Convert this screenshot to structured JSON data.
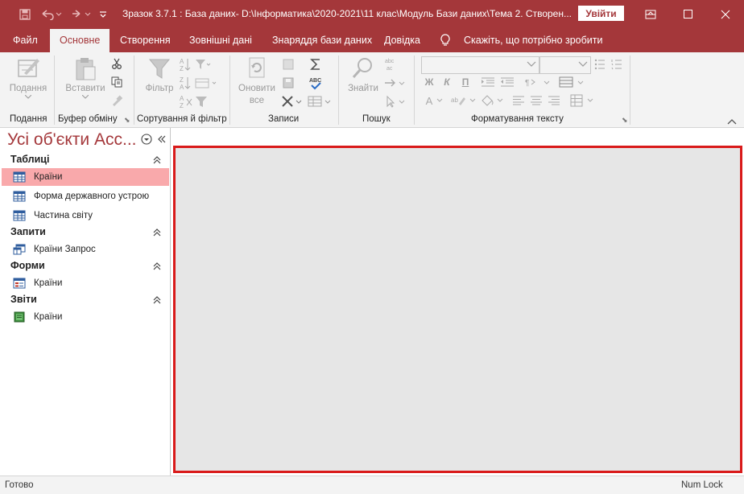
{
  "window": {
    "title": "Зразок 3.7.1 : База даних- D:\\Інформатика\\2020-2021\\11 клас\\Модуль Бази даних\\Тема 2. Створен...",
    "signin_label": "Увійти"
  },
  "tabs": [
    {
      "label": "Файл"
    },
    {
      "label": "Основне"
    },
    {
      "label": "Створення"
    },
    {
      "label": "Зовнішні дані"
    },
    {
      "label": "Знаряддя бази даних"
    },
    {
      "label": "Довідка"
    }
  ],
  "tell_me": "Скажіть, що потрібно зробити",
  "ribbon": {
    "views": {
      "label": "Подання",
      "group": "Подання"
    },
    "clipboard": {
      "paste": "Вставити",
      "group": "Буфер обміну"
    },
    "sort": {
      "filter": "Фільтр",
      "group": "Сортування й фільтр"
    },
    "records": {
      "refresh": "Оновити",
      "refresh2": "все",
      "group": "Записи"
    },
    "find": {
      "label": "Знайти",
      "group": "Пошук"
    },
    "format": {
      "bold": "Ж",
      "italic": "К",
      "underline": "П",
      "font_color": "A",
      "group": "Форматування тексту"
    }
  },
  "nav": {
    "title": "Усі об'єкти Acc...",
    "groups": [
      {
        "label": "Таблиці",
        "items": [
          "Країни",
          "Форма державного устрою",
          "Частина світу"
        ]
      },
      {
        "label": "Запити",
        "items": [
          "Країни Запрос"
        ]
      },
      {
        "label": "Форми",
        "items": [
          "Країни"
        ]
      },
      {
        "label": "Звіти",
        "items": [
          "Країни"
        ]
      }
    ]
  },
  "status": {
    "left": "Готово",
    "right": "Num Lock"
  },
  "colors": {
    "accent": "#a4373a",
    "selection": "#f9a9ab",
    "highlight_border": "#d91a1a"
  }
}
